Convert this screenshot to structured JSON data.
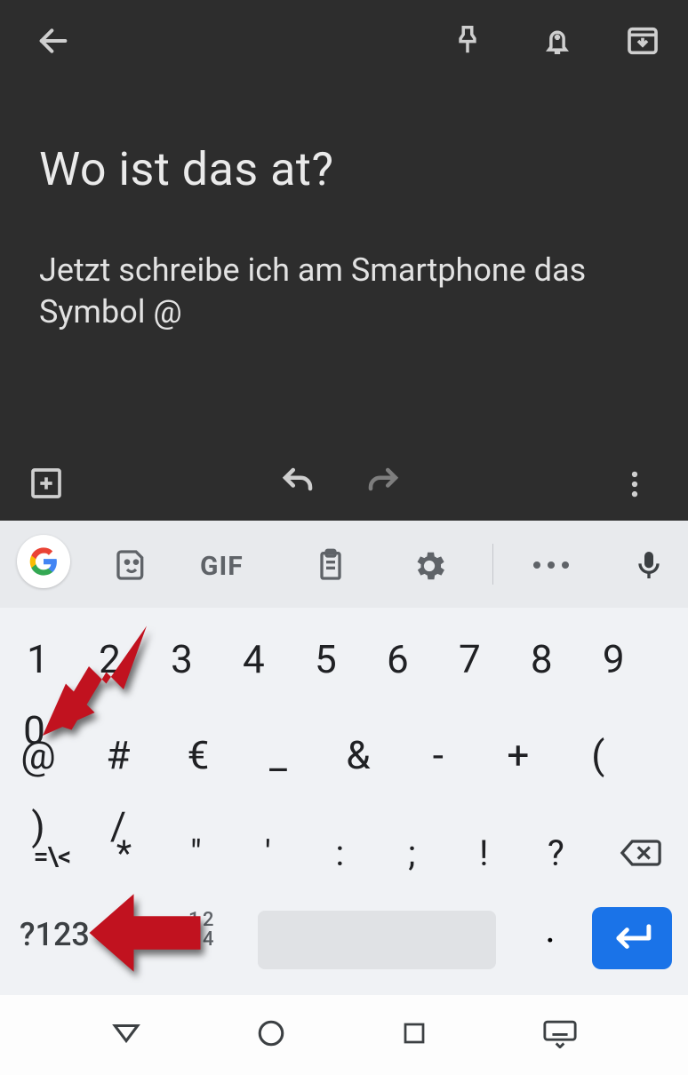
{
  "editor": {
    "title": "Wo ist das at?",
    "body": "Jetzt schreibe ich am Smartphone das Symbol @"
  },
  "kbd_toolbar": {
    "gif_label": "GIF"
  },
  "keyboard": {
    "row1": [
      "1",
      "2",
      "3",
      "4",
      "5",
      "6",
      "7",
      "8",
      "9",
      "0"
    ],
    "row2": [
      "@",
      "#",
      "€",
      "_",
      "&",
      "-",
      "+",
      "(",
      ")",
      "/"
    ],
    "row3_switch": "=\\<",
    "row3": [
      "*",
      "\"",
      "'",
      ":",
      ";",
      "!",
      "?"
    ],
    "row4_abc": "?123",
    "row4_lang_top": "1 2",
    "row4_lang_bot": "3 4",
    "row4_period": "."
  }
}
